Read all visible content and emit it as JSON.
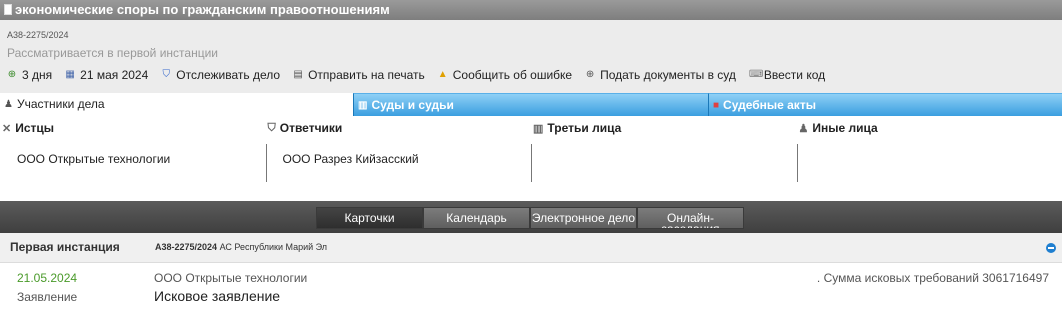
{
  "title_bar": {
    "text": "экономические споры по гражданским правоотношениям"
  },
  "case": {
    "number": "А38-2275/2024",
    "status": "Рассматривается в первой инстанции"
  },
  "actions": [
    {
      "label": "3 дня",
      "icon": "clock-icon"
    },
    {
      "label": "21 мая 2024",
      "icon": "calendar-icon"
    },
    {
      "label": "Отслеживать дело",
      "icon": "shield-icon"
    },
    {
      "label": "Отправить на печать",
      "icon": "printer-icon"
    },
    {
      "label": "Сообщить об ошибке",
      "icon": "warning-icon"
    },
    {
      "label": "Подать документы в суд",
      "icon": "plus-circle-icon"
    },
    {
      "label": "Ввести код",
      "icon": "code-icon"
    }
  ],
  "tabs": [
    {
      "label": "Участники дела",
      "active": true
    },
    {
      "label": "Суды и судьи",
      "active": false
    },
    {
      "label": "Судебные акты",
      "active": false
    }
  ],
  "parties": [
    {
      "heading": "Истцы",
      "value": "ООО Открытые технологии"
    },
    {
      "heading": "Ответчики",
      "value": "ООО Разрез Кийзасский"
    },
    {
      "heading": "Третьи лица",
      "value": ""
    },
    {
      "heading": "Иные лица",
      "value": ""
    }
  ],
  "view_buttons": [
    {
      "label": "Карточки",
      "active": true
    },
    {
      "label": "Календарь",
      "active": false
    },
    {
      "label": "Электронное дело",
      "active": false
    },
    {
      "label": "Онлайн-заседания",
      "active": false
    }
  ],
  "instance": {
    "title": "Первая инстанция",
    "case_number": "А38-2275/2024",
    "court": "АС Республики Марий Эл"
  },
  "document": {
    "date": "21.05.2024",
    "type": "Заявление",
    "party": "ООО Открытые технологии",
    "title": "Исковое заявление",
    "sum_text": ". Сумма исковых требований 3061716497"
  },
  "colors": {
    "tab_blue": "#3a9ee0",
    "date_green": "#4a9a2a",
    "collapse_blue": "#1f7fd0"
  }
}
